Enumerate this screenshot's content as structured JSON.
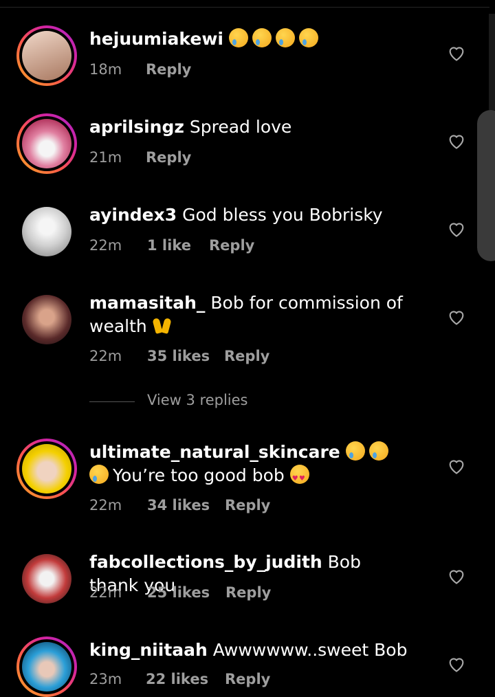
{
  "comments": [
    {
      "user": "hejuumiakewi",
      "text": "",
      "emojis": [
        "cry",
        "cry",
        "cry",
        "cry"
      ],
      "time": "18m",
      "likes": "",
      "reply": "Reply",
      "ring": true,
      "avatar_color": "#d9b3a0"
    },
    {
      "user": "aprilsingz",
      "text": "Spread love",
      "emojis": [],
      "time": "21m",
      "likes": "",
      "reply": "Reply",
      "ring": true,
      "avatar_color": "#e07fa0"
    },
    {
      "user": "ayindex3",
      "text": "God bless you Bobrisky",
      "emojis": [],
      "time": "22m",
      "likes": "1 like",
      "reply": "Reply",
      "ring": false,
      "avatar_color": "#cfcfcf"
    },
    {
      "user": "mamasitah_",
      "text": "Bob for commission of wealth",
      "emojis": [
        "hands"
      ],
      "time": "22m",
      "likes": "35 likes",
      "reply": "Reply",
      "ring": false,
      "avatar_color": "#5a2a2a"
    },
    {
      "user": "ultimate_natural_skincare",
      "text": "You’re too good bob",
      "emojis": [
        "cry",
        "cry",
        "cry"
      ],
      "trailing_emojis": [
        "love"
      ],
      "time": "22m",
      "likes": "34 likes",
      "reply": "Reply",
      "ring": true,
      "avatar_color": "#f4d000"
    },
    {
      "user": "fabcollections_by_judith",
      "text": "Bob thank you",
      "emojis": [],
      "time": "22m",
      "likes": "25 likes",
      "reply": "Reply",
      "ring": false,
      "avatar_color": "#c23b3b"
    },
    {
      "user": "king_niitaah",
      "text": "Awwwwww..sweet Bob",
      "emojis": [],
      "time": "23m",
      "likes": "22 likes",
      "reply": "Reply",
      "ring": true,
      "avatar_color": "#2b9fd8"
    }
  ],
  "view_replies": "View 3 replies",
  "icons": {
    "like": "heart-outline-icon"
  }
}
